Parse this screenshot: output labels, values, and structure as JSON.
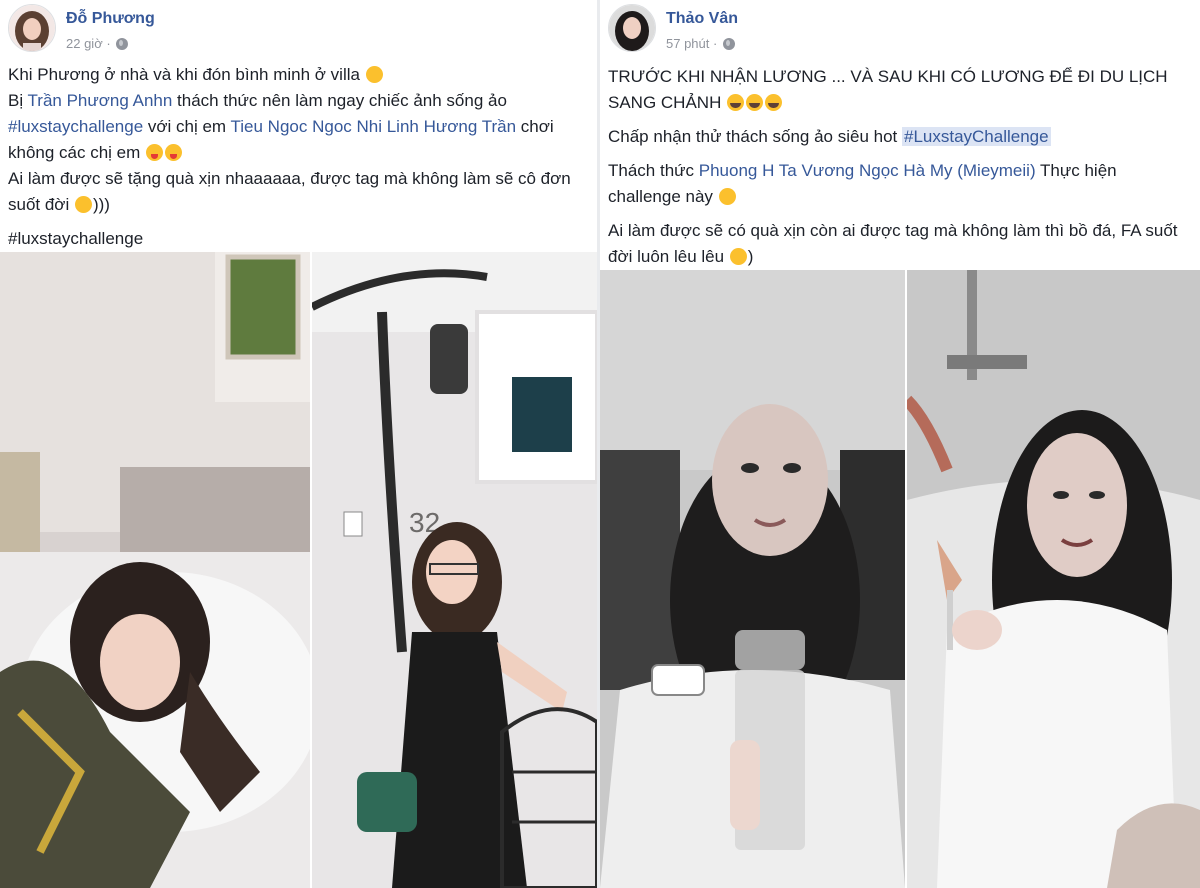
{
  "left_post": {
    "author": "Đỗ Phương",
    "time": "22 giờ ·",
    "line1": "Khi Phương ở nhà và khi đón bình minh ở villa ",
    "line2_pre": "Bị ",
    "tag_person": "Trần Phương Anhn",
    "line2_post": " thách thức nên làm ngay chiếc ảnh sống ảo",
    "hashtag_inline": "#luxstaychallenge",
    "line3_mid": " với chị em ",
    "tag_friends": "Tieu Ngoc Ngoc Nhi Linh Hương Trần",
    "line3_post": " chơi không các chị em ",
    "line4": "Ai làm được sẽ tặng quà xịn nhaaaaaa, được tag mà không làm sẽ cô đơn suốt đời ",
    "line4_end": ")))",
    "hashtag_footer": "#luxstaychallenge"
  },
  "right_post": {
    "author": "Thảo Vân",
    "time": "57 phút ·",
    "line1": "TRƯỚC KHI NHẬN LƯƠNG ... VÀ SAU KHI CÓ LƯƠNG ĐỂ ĐI DU LỊCH SANG CHẢNH ",
    "line2_pre": "Chấp nhận thử thách sống ảo siêu hot ",
    "hashtag": "#LuxstayChallenge",
    "line3_pre": "Thách thức ",
    "tag_friends": "Phuong H Ta Vương Ngọc Hà My (Mieymeii)",
    "line3_post": " Thực hiện challenge này ",
    "line4": "Ai làm được sẽ có quà xịn còn ai được tag mà không làm thì bồ đá, FA suốt đời luôn lêu lêu ",
    "line4_end": ")"
  },
  "photo_text": {
    "house_number": "32"
  },
  "colors": {
    "link": "#365899",
    "hashtag_highlight": "#dce4f4",
    "text": "#1d2129",
    "meta": "#90949c"
  }
}
